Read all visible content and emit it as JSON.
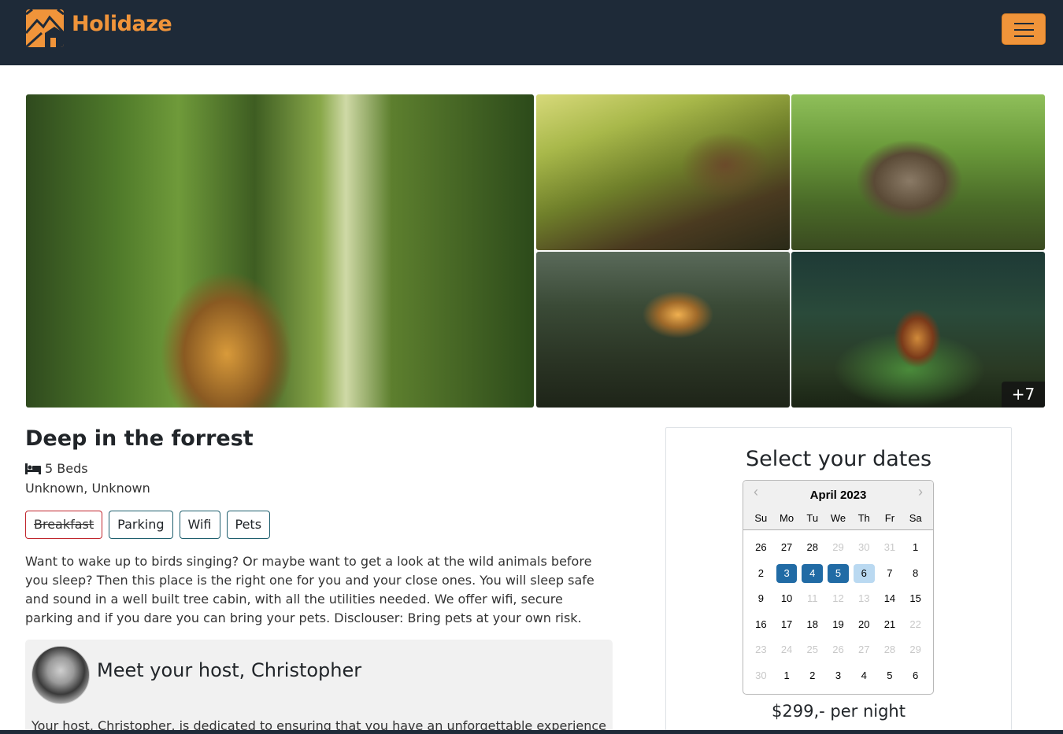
{
  "navbar": {
    "brand": "Holidaze",
    "logo_icon": "mountain-house-icon",
    "menu_icon": "hamburger-icon",
    "accent_color": "#f0943a",
    "bg_color": "#1e2a38"
  },
  "gallery": {
    "more_count": "+7"
  },
  "listing": {
    "title": "Deep in the forrest",
    "beds": "5 Beds",
    "location": "Unknown, Unknown",
    "tags": [
      {
        "label": "Breakfast",
        "available": false
      },
      {
        "label": "Parking",
        "available": true
      },
      {
        "label": "Wifi",
        "available": true
      },
      {
        "label": "Pets",
        "available": true
      }
    ],
    "description": "Want to wake up to birds singing? Or maybe want to get a look at the wild animals before you sleep? Then this place is the right one for you and your close ones. You will sleep safe and sound in a well built tree cabin, with all the utilities needed. We offer wifi, secure parking and if you dare you can bring your pets. Disclouser: Bring pets at your own risk."
  },
  "host": {
    "title": "Meet your host, Christopher",
    "text": "Your host, Christopher, is dedicated to ensuring that you have an unforgettable experience"
  },
  "booking": {
    "title": "Select your dates",
    "month": "April 2023",
    "weekdays": [
      "Su",
      "Mo",
      "Tu",
      "We",
      "Th",
      "Fr",
      "Sa"
    ],
    "days": [
      {
        "d": "26",
        "s": ""
      },
      {
        "d": "27",
        "s": ""
      },
      {
        "d": "28",
        "s": ""
      },
      {
        "d": "29",
        "s": "dim"
      },
      {
        "d": "30",
        "s": "dim"
      },
      {
        "d": "31",
        "s": "dim"
      },
      {
        "d": "1",
        "s": ""
      },
      {
        "d": "2",
        "s": ""
      },
      {
        "d": "3",
        "s": "sel"
      },
      {
        "d": "4",
        "s": "sel"
      },
      {
        "d": "5",
        "s": "sel"
      },
      {
        "d": "6",
        "s": "pending"
      },
      {
        "d": "7",
        "s": ""
      },
      {
        "d": "8",
        "s": ""
      },
      {
        "d": "9",
        "s": ""
      },
      {
        "d": "10",
        "s": ""
      },
      {
        "d": "11",
        "s": "dim"
      },
      {
        "d": "12",
        "s": "dim"
      },
      {
        "d": "13",
        "s": "dim"
      },
      {
        "d": "14",
        "s": ""
      },
      {
        "d": "15",
        "s": ""
      },
      {
        "d": "16",
        "s": ""
      },
      {
        "d": "17",
        "s": ""
      },
      {
        "d": "18",
        "s": ""
      },
      {
        "d": "19",
        "s": ""
      },
      {
        "d": "20",
        "s": ""
      },
      {
        "d": "21",
        "s": ""
      },
      {
        "d": "22",
        "s": "dim"
      },
      {
        "d": "23",
        "s": "dim"
      },
      {
        "d": "24",
        "s": "dim"
      },
      {
        "d": "25",
        "s": "dim"
      },
      {
        "d": "26",
        "s": "dim"
      },
      {
        "d": "27",
        "s": "dim"
      },
      {
        "d": "28",
        "s": "dim"
      },
      {
        "d": "29",
        "s": "dim"
      },
      {
        "d": "30",
        "s": "dim"
      },
      {
        "d": "1",
        "s": ""
      },
      {
        "d": "2",
        "s": ""
      },
      {
        "d": "3",
        "s": ""
      },
      {
        "d": "4",
        "s": ""
      },
      {
        "d": "5",
        "s": ""
      },
      {
        "d": "6",
        "s": ""
      }
    ],
    "price": "$299,- per night"
  }
}
